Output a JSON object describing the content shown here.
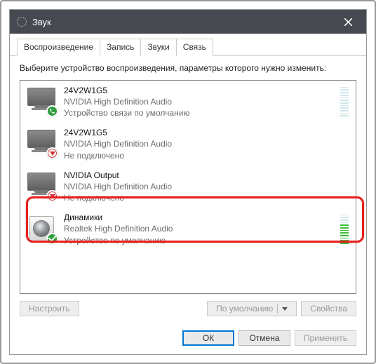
{
  "window": {
    "title": "Звук"
  },
  "tabs": [
    "Воспроизведение",
    "Запись",
    "Звуки",
    "Связь"
  ],
  "instruction": "Выберите устройство воспроизведения, параметры которого нужно изменить:",
  "devices": [
    {
      "name": "24V2W1G5",
      "driver": "NVIDIA High Definition Audio",
      "status": "Устройство связи по умолчанию",
      "icon": "monitor",
      "badge": "phone",
      "level": 0
    },
    {
      "name": "24V2W1G5",
      "driver": "NVIDIA High Definition Audio",
      "status": "Не подключено",
      "icon": "monitor",
      "badge": "disconnected"
    },
    {
      "name": "NVIDIA Output",
      "driver": "NVIDIA High Definition Audio",
      "status": "Не подключено",
      "icon": "monitor",
      "badge": "disconnected"
    },
    {
      "name": "Динамики",
      "driver": "Realtek High Definition Audio",
      "status": "Устройство по умолчанию",
      "icon": "speaker",
      "badge": "default",
      "level": 8,
      "highlighted": true
    }
  ],
  "buttons": {
    "configure": "Настроить",
    "set_default": "По умолчанию",
    "properties": "Свойства",
    "ok": "ОК",
    "cancel": "Отмена",
    "apply": "Применить"
  },
  "colors": {
    "titlebar": "#46494f",
    "highlight_ring": "#e52020",
    "ok_badge": "#2e9e3e",
    "focus_border": "#0078d7"
  }
}
